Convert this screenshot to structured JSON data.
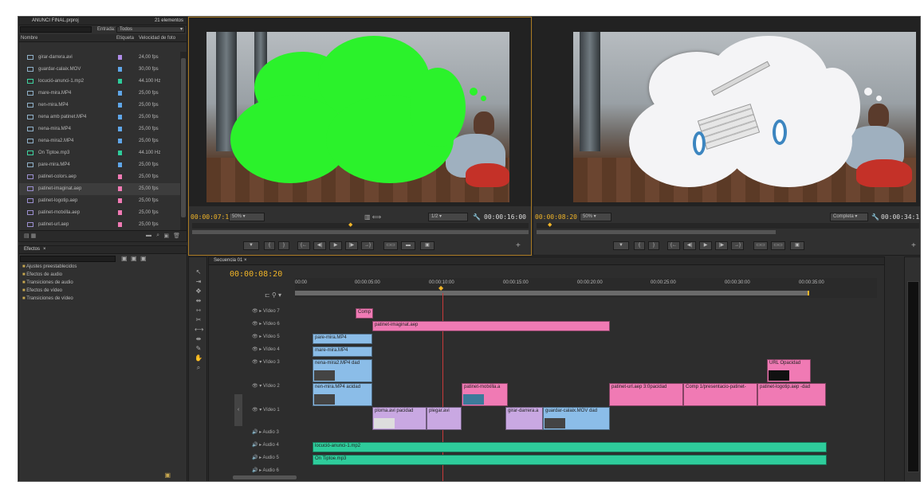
{
  "project": {
    "title": "ANUNCI FINAL.prproj",
    "count": "21 elementos",
    "filter_label": "Entrada:",
    "filter_value": "Todos",
    "col_name": "Nombre",
    "col_label": "Etiqueta",
    "col_rate": "Velocidad de foto",
    "items": [
      {
        "name": "girar-darrera.avi",
        "rate": "24,00 fps",
        "label": "#b08ce8"
      },
      {
        "name": "guardar-calaix.MOV",
        "rate": "30,00 fps",
        "label": "#5fa6e8"
      },
      {
        "name": "locució-anunci-1.mp2",
        "rate": "44.100 Hz",
        "label": "#2ecc9b"
      },
      {
        "name": "mare-mira.MP4",
        "rate": "25,00 fps",
        "label": "#5fa6e8"
      },
      {
        "name": "nen-mira.MP4",
        "rate": "25,00 fps",
        "label": "#5fa6e8"
      },
      {
        "name": "nena amb patinet.MP4",
        "rate": "25,00 fps",
        "label": "#5fa6e8"
      },
      {
        "name": "nena-mira.MP4",
        "rate": "25,00 fps",
        "label": "#5fa6e8"
      },
      {
        "name": "nena-mira2.MP4",
        "rate": "25,00 fps",
        "label": "#5fa6e8"
      },
      {
        "name": "On Tiptoe.mp3",
        "rate": "44.100 Hz",
        "label": "#2ecc9b"
      },
      {
        "name": "pare-mira.MP4",
        "rate": "25,00 fps",
        "label": "#5fa6e8"
      },
      {
        "name": "patinet-colors.aep",
        "rate": "25,00 fps",
        "label": "#f07ab4"
      },
      {
        "name": "patinet-imaginat.aep",
        "rate": "25,00 fps",
        "label": "#f07ab4"
      },
      {
        "name": "patinet-logotip.aep",
        "rate": "25,00 fps",
        "label": "#f07ab4"
      },
      {
        "name": "patinet-motxilla.aep",
        "rate": "25,00 fps",
        "label": "#f07ab4"
      },
      {
        "name": "patinet-url.aep",
        "rate": "25,00 fps",
        "label": "#f07ab4"
      }
    ]
  },
  "effects": {
    "tab": "Efectos",
    "items": [
      "Ajustes preestablecidos",
      "Efectos de audio",
      "Transiciones de audio",
      "Efectos de vídeo",
      "Transiciones de vídeo"
    ]
  },
  "source": {
    "timecode": "00:00:07:19",
    "zoom": "50%",
    "fraction": "1/2",
    "duration": "00:00:16:00"
  },
  "program": {
    "timecode": "00:00:08:20",
    "zoom": "50%",
    "quality": "Completa",
    "duration": "00:00:34:1"
  },
  "timeline": {
    "tab": "Secuencia 01",
    "timecode": "00:00:08:20",
    "ruler": [
      "00:00",
      "00:00:05:00",
      "00:00:10:00",
      "00:00:15:00",
      "00:00:20:00",
      "00:00:25:00",
      "00:00:30:00",
      "00:00:35:00"
    ],
    "tracks": [
      "Vídeo 7",
      "Vídeo 6",
      "Vídeo 5",
      "Vídeo 4",
      "Vídeo 3",
      "Vídeo 2",
      "Vídeo 1",
      "Audio 3",
      "Audio 4",
      "Audio 5",
      "Audio 6"
    ],
    "clips": {
      "comp": "Comp",
      "imaginat": "patinet-imaginat.aep",
      "pare": "pare-mira.MP4",
      "mare": "mare-mira.MP4",
      "nena2": "nena-mira2.MP4",
      "nena2b": "dad",
      "nen": "nen-mira.MP4",
      "nenb": "acidad",
      "motxilla": "patinet-motxilla.a",
      "url": "patinet-url.aep",
      "urlb": "3:0pacidad",
      "comp1": "Comp 1/presentacio-patinet-",
      "logotip": "patinet-logotip.aep",
      "logotipb": "-dad",
      "urlv3": "URL",
      "urlv3b": "Opacidad",
      "ploma": "ploma.avi",
      "ploma2": "pacidad",
      "plegar": "plegar.avi",
      "girar": "girar-darrera.a",
      "guardar": "guardar-calaix.MOV",
      "guardarb": "dad",
      "locucio": "locució-anunci-1.mp2",
      "tiptoe": "On Tiptoe.mp3"
    }
  }
}
